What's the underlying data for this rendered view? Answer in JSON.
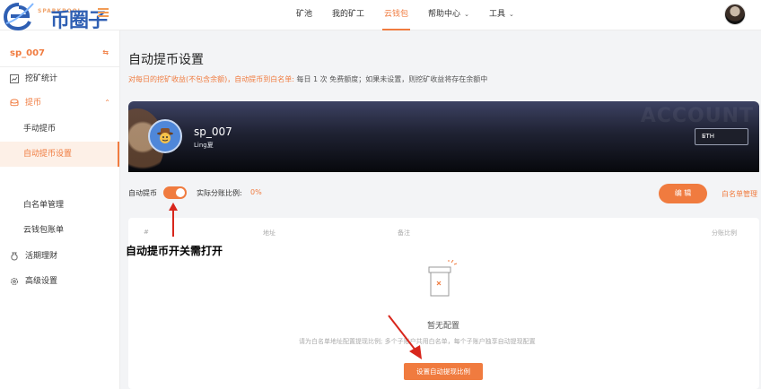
{
  "logo": {
    "brand_small": "SPARKPOOL",
    "watermark_text": "币圈子"
  },
  "nav": {
    "items": [
      {
        "label": "矿池",
        "has_caret": false,
        "active": false
      },
      {
        "label": "我的矿工",
        "has_caret": false,
        "active": false
      },
      {
        "label": "云钱包",
        "has_caret": false,
        "active": true
      },
      {
        "label": "帮助中心",
        "has_caret": true,
        "active": false
      },
      {
        "label": "工具",
        "has_caret": true,
        "active": false
      }
    ]
  },
  "sidebar": {
    "username": "sp_007",
    "items": [
      {
        "label": "挖矿统计",
        "icon": "chart-icon"
      },
      {
        "label": "提币",
        "icon": "coin-icon"
      },
      {
        "label": "手动提币"
      },
      {
        "label": "自动提币设置"
      },
      {
        "label": "白名单管理"
      },
      {
        "label": "云钱包账单"
      },
      {
        "label": "活期理财",
        "icon": "money-bag-icon"
      },
      {
        "label": "高级设置",
        "icon": "gear-icon"
      }
    ]
  },
  "page": {
    "title": "自动提币设置",
    "notice_highlight": "对每日的挖矿收益(不包含余额)，自动提币到白名单:",
    "notice_rest": " 每日 1 次 免费额度；如果未设置，则挖矿收益将存在余额中"
  },
  "banner": {
    "watermark": "ACCOUNT",
    "name": "sp_007",
    "subname": "Ling夏",
    "coin": "ETH"
  },
  "auto": {
    "toggle_label": "自动提币",
    "toggle_on": true,
    "ratio_label": "实际分账比例:",
    "ratio_value": "0%",
    "edit_label": "编 辑",
    "whitelist_link": "白名单管理"
  },
  "table": {
    "headers": [
      "#",
      "地址",
      "备注",
      "分账比例"
    ],
    "empty_title": "暂无配置",
    "empty_desc": "请为白名单地址配置提现比例;  多个子账户共用白名单，每个子账户独享自动提现配置",
    "config_button": "设置自动提现比例"
  },
  "annotation": "自动提币开关需打开",
  "colors": {
    "accent": "#f07b3f",
    "banner_dark": "#07080c"
  }
}
